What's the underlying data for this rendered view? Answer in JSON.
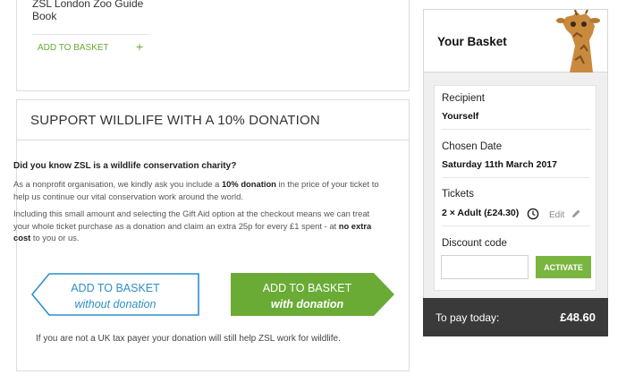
{
  "product": {
    "title": "ZSL London Zoo Guide Book",
    "add_label": "ADD TO BASKET",
    "add_icon": "+"
  },
  "donation": {
    "heading": "SUPPORT WILDLIFE WITH A 10% DONATION",
    "question": "Did you know ZSL is a wildlife conservation charity?",
    "p1_pre": "As a nonprofit organisation, we kindly ask you include a ",
    "p1_bold": "10% donation",
    "p1_post": " in the price of your ticket to help us continue our vital conservation work around the world.",
    "p2_pre": "Including this small amount and selecting the Gift Aid option at the checkout means we can treat your whole ticket purchase as a donation and claim an extra 25p for every £1 spent - at ",
    "p2_bold": "no extra cost",
    "p2_post": " to you or us.",
    "btn_without_l1": "ADD TO BASKET",
    "btn_without_l2": "without donation",
    "btn_with_l1": "ADD TO BASKET",
    "btn_with_l2": "with donation",
    "note": "If you are not a UK tax payer your donation will still help ZSL work for wildlife."
  },
  "basket": {
    "title": "Your Basket",
    "recipient_label": "Recipient",
    "recipient_value": "Yourself",
    "date_label": "Chosen Date",
    "date_value": "Saturday 11th March 2017",
    "tickets_label": "Tickets",
    "tickets_value": "2 × Adult (£24.30)",
    "edit_label": "Edit",
    "discount_label": "Discount code",
    "discount_placeholder": "",
    "activate_label": "ACTIVATE",
    "topay_label": "To pay today:",
    "topay_amount": "£48.60"
  },
  "colors": {
    "green": "#7ab540",
    "dark_green": "#5e9c2e",
    "blue": "#2e8fc9",
    "dark_bar": "#3a3a3a"
  },
  "icons": [
    "plus-icon",
    "clock-icon",
    "pencil-icon",
    "giraffe-image"
  ]
}
